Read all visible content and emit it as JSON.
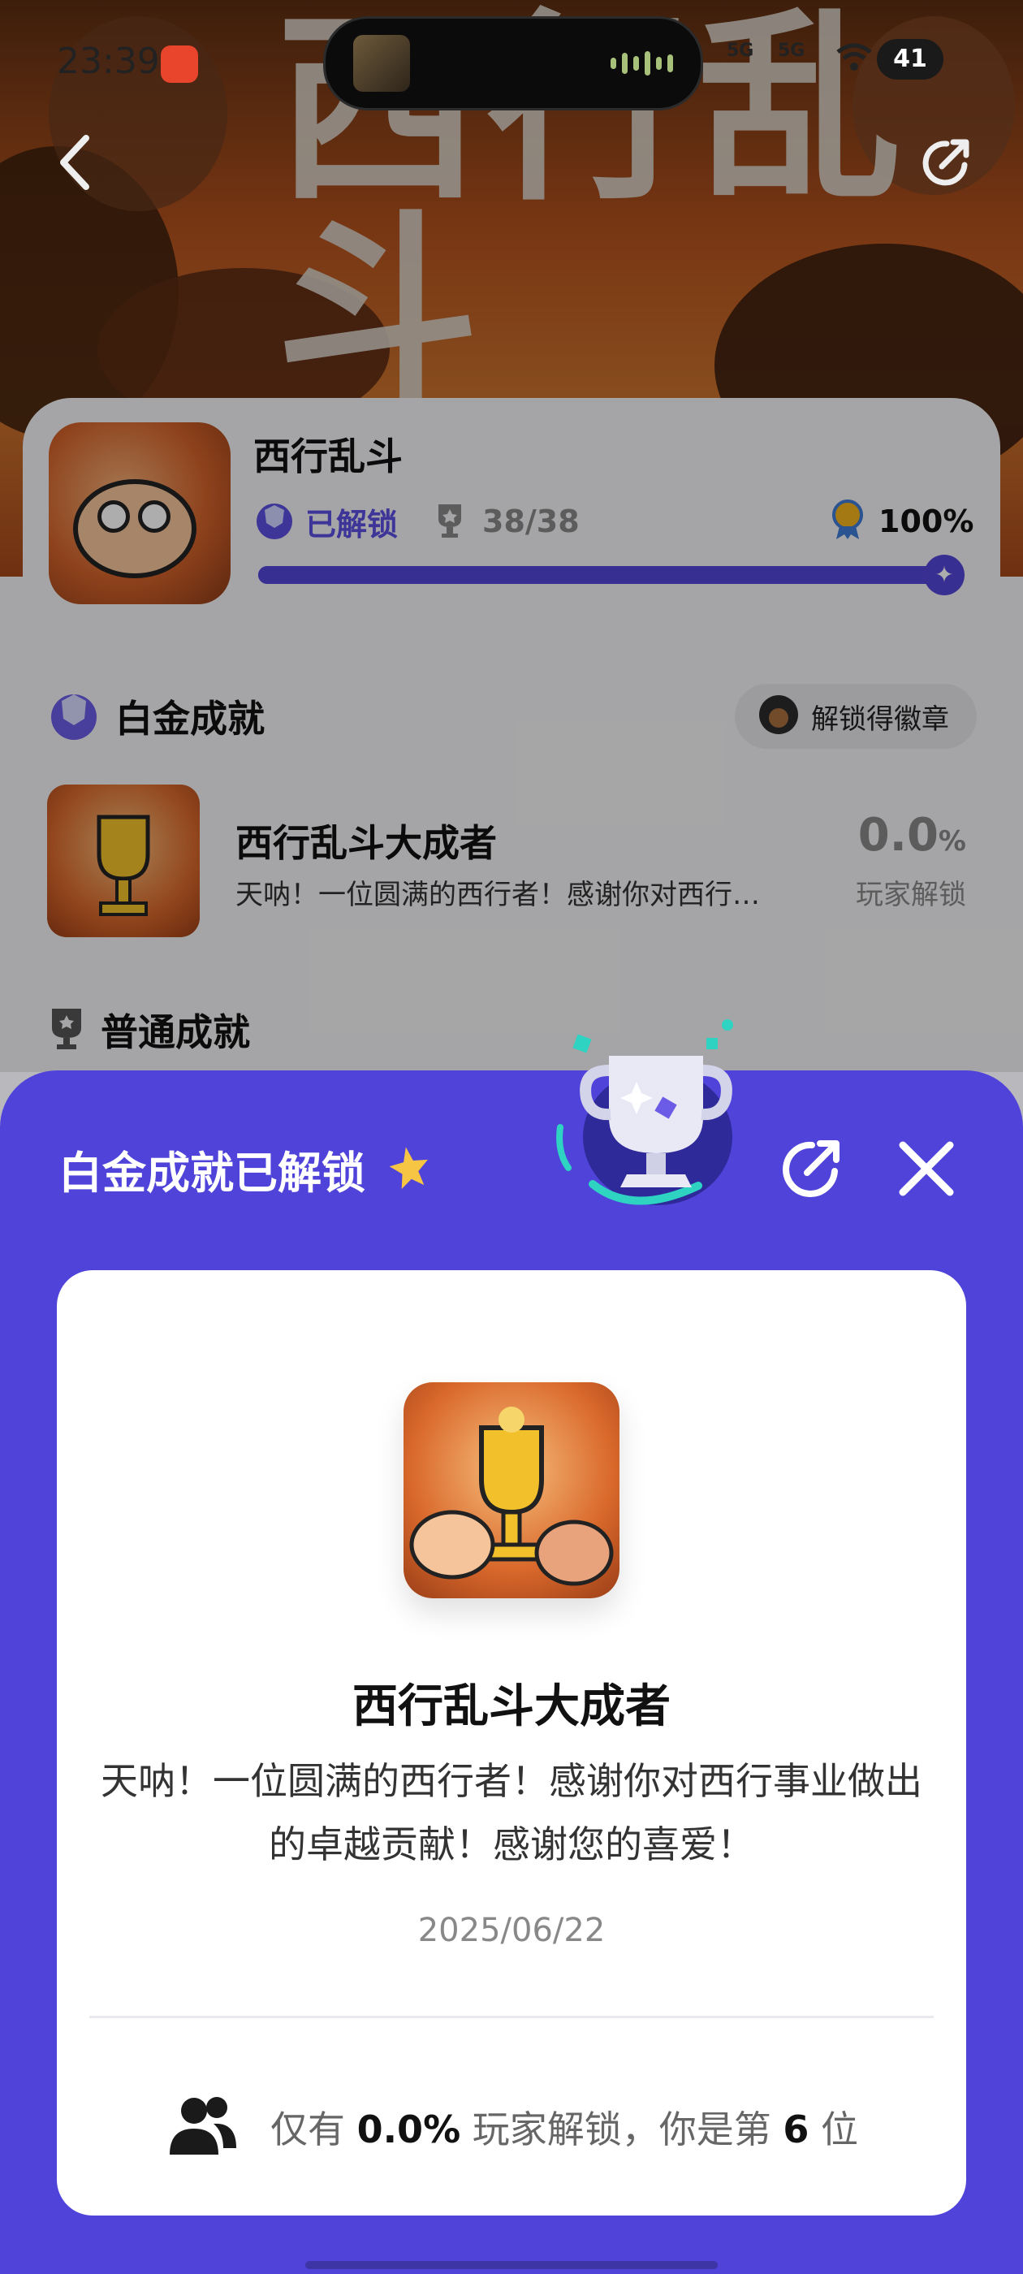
{
  "status_bar": {
    "time": "23:39",
    "network_1": "5G",
    "network_2": "5G",
    "battery": "41"
  },
  "hero": {
    "title_art": "西行乱斗"
  },
  "game": {
    "name": "西行乱斗",
    "unlocked_label": "已解锁",
    "achievement_count": "38/38",
    "completion": "100%",
    "progress_fraction": 1.0
  },
  "platinum_section": {
    "title": "白金成就",
    "badge_chip_label": "解锁得徽章",
    "achievement": {
      "name": "西行乱斗大成者",
      "description_short": "天呐！一位圆满的西行者！感谢你对西行…",
      "rate_value": "0.0",
      "rate_unit": "%",
      "rate_label": "玩家解锁"
    }
  },
  "normal_section": {
    "title": "普通成就"
  },
  "sheet": {
    "title": "白金成就已解锁",
    "card": {
      "name": "西行乱斗大成者",
      "description": "天呐！一位圆满的西行者！感谢你对西行事业做出的卓越贡献！感谢您的喜爱！",
      "date": "2025/06/22",
      "foot_prefix": "仅有",
      "foot_rate": "0.0%",
      "foot_middle": "玩家解锁，你是第",
      "foot_rank": "6",
      "foot_suffix": "位"
    }
  },
  "colors": {
    "accent": "#4f43da",
    "progress": "#5346d8",
    "hero_orange": "#c9722d"
  },
  "icons": [
    "back-icon",
    "share-icon",
    "close-icon",
    "trophy-icon",
    "sparkle-star-icon",
    "platinum-icon",
    "cup-icon",
    "medal-icon",
    "users-icon"
  ]
}
